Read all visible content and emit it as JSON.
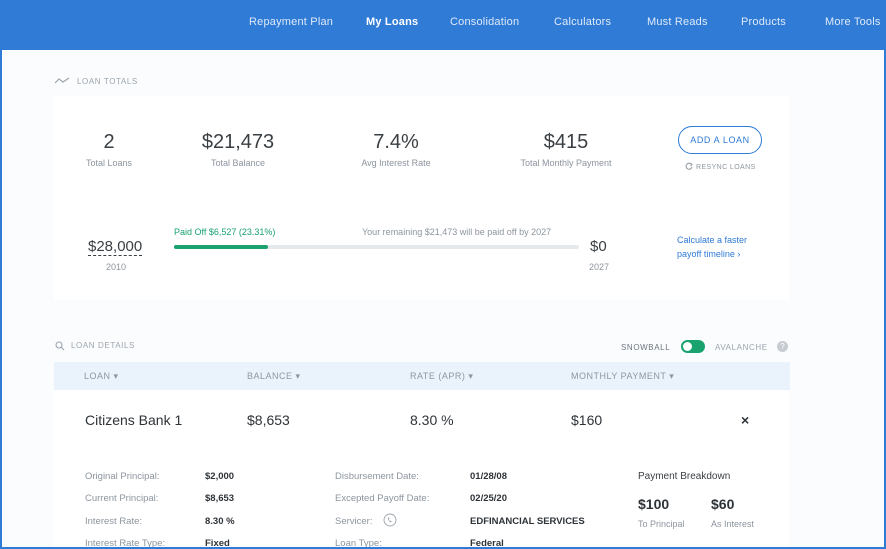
{
  "nav": {
    "items": [
      {
        "label": "Repayment Plan",
        "active": false
      },
      {
        "label": "My Loans",
        "active": true
      },
      {
        "label": "Consolidation",
        "active": false
      },
      {
        "label": "Calculators",
        "active": false
      },
      {
        "label": "Must Reads",
        "active": false
      },
      {
        "label": "Products",
        "active": false
      },
      {
        "label": "More Tools",
        "active": false
      }
    ]
  },
  "totals": {
    "section_label": "LOAN TOTALS",
    "stats": [
      {
        "value": "2",
        "label": "Total Loans"
      },
      {
        "value": "$21,473",
        "label": "Total Balance"
      },
      {
        "value": "7.4%",
        "label": "Avg Interest Rate"
      },
      {
        "value": "$415",
        "label": "Total Monthly Payment"
      }
    ],
    "add_loan_label": "ADD A LOAN",
    "resync_label": "RESYNC LOANS"
  },
  "payoff": {
    "start_amount": "$28,000",
    "start_year": "2010",
    "end_amount": "$0",
    "end_year": "2027",
    "paid_off_text": "Paid Off $6,527 (23.31%)",
    "paid_fraction": 0.2331,
    "remaining_text": "Your remaining $21,473 will be paid off by 2027",
    "faster_link_line1": "Calculate a faster",
    "faster_link_line2": "payoff timeline",
    "accent_color": "#1aa36f"
  },
  "details": {
    "section_label": "LOAN DETAILS",
    "snowball_label": "SNOWBALL",
    "avalanche_label": "AVALANCHE",
    "help_label": "?",
    "columns": {
      "loan": "LOAN",
      "balance": "BALANCE",
      "rate": "RATE (APR)",
      "monthly": "MONTHLY PAYMENT"
    },
    "loan": {
      "name": "Citizens Bank 1",
      "balance": "$8,653",
      "rate": "8.30 %",
      "monthly": "$160",
      "close": "×"
    },
    "left_fields": [
      {
        "label": "Original Principal:",
        "value": "$2,000"
      },
      {
        "label": "Current Principal:",
        "value": "$8,653"
      },
      {
        "label": "Interest Rate:",
        "value": "8.30 %"
      },
      {
        "label": "Interest Rate Type:",
        "value": "Fixed"
      }
    ],
    "mid_fields": [
      {
        "label": "Disbursement Date:",
        "value": "01/28/08"
      },
      {
        "label": "Excepted Payoff Date:",
        "value": "02/25/20"
      },
      {
        "label": "Servicer:",
        "value": "EDFINANCIAL SERVICES"
      },
      {
        "label": "Loan Type:",
        "value": "Federal"
      }
    ],
    "breakdown": {
      "title": "Payment Breakdown",
      "principal_value": "$100",
      "principal_label": "To Principal",
      "interest_value": "$60",
      "interest_label": "As Interest"
    }
  }
}
